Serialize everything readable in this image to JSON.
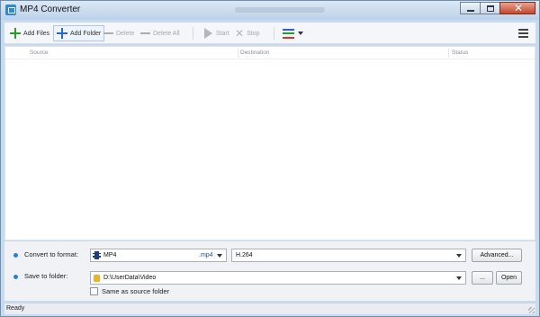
{
  "window": {
    "title": "MP4 Converter"
  },
  "toolbar": {
    "add_files": "Add Files",
    "add_folder": "Add Folder",
    "delete": "Delete",
    "delete_all": "Delete All",
    "start": "Start",
    "stop": "Stop",
    "view_colors": [
      "#2a66c9",
      "#2c9a2c",
      "#d23a2a"
    ]
  },
  "list": {
    "columns": [
      "Source",
      "Destination",
      "Status"
    ]
  },
  "convert": {
    "label": "Convert to format:",
    "format_name": "MP4",
    "format_ext": ".mp4",
    "codec": "H.264",
    "advanced_button": "Advanced..."
  },
  "save": {
    "label": "Save to folder:",
    "path": "D:\\UserData\\Video",
    "browse_button": "...",
    "open_button": "Open",
    "same_as_source_label": "Same as source folder",
    "same_as_source_checked": false
  },
  "status_bar": {
    "text": "Ready"
  }
}
